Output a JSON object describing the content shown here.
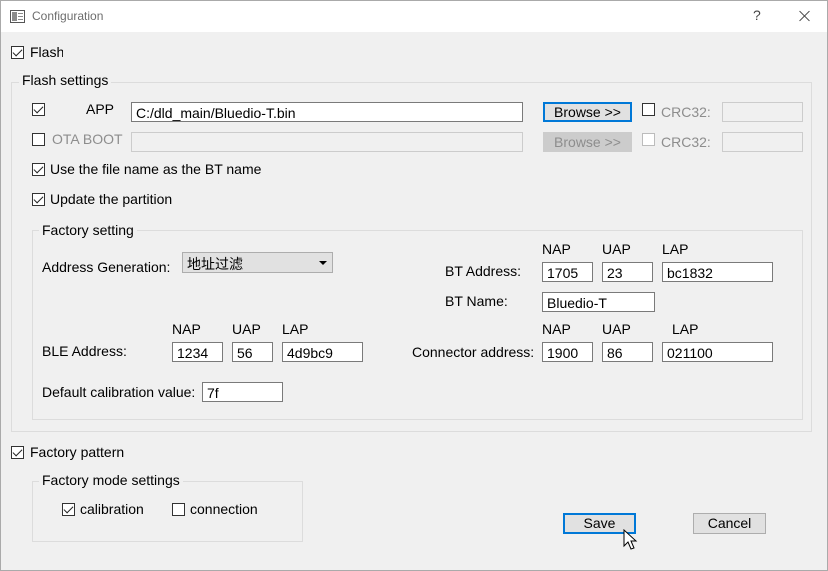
{
  "window": {
    "title": "Configuration",
    "help_label": "?"
  },
  "flash": {
    "label": "Flash",
    "checked": true,
    "settings_title": "Flash settings",
    "app": {
      "label": "APP",
      "checked": true,
      "path": "C:/dld_main/Bluedio-T.bin",
      "browse_label": "Browse >>",
      "crc_label": "CRC32:",
      "crc_value": "",
      "crc_checked": false
    },
    "ota": {
      "label": "OTA BOOT",
      "checked": false,
      "path": "",
      "browse_label": "Browse >>",
      "crc_label": "CRC32:",
      "crc_value": ""
    },
    "use_filename_label": "Use the file name as the BT name",
    "update_partition_label": "Update the partition"
  },
  "factory_setting": {
    "title": "Factory setting",
    "address_generation_label": "Address Generation:",
    "address_generation_value": "地址过滤",
    "bt_address": {
      "label": "BT Address:",
      "nap_label": "NAP",
      "uap_label": "UAP",
      "lap_label": "LAP",
      "nap": "1705",
      "uap": "23",
      "lap": "bc1832"
    },
    "bt_name": {
      "label": "BT Name:",
      "value": "Bluedio-T"
    },
    "ble_address": {
      "label": "BLE Address:",
      "nap_label": "NAP",
      "uap_label": "UAP",
      "lap_label": "LAP",
      "nap": "1234",
      "uap": "56",
      "lap": "4d9bc9"
    },
    "connector_address": {
      "label": "Connector address:",
      "nap_label": "NAP",
      "uap_label": "UAP",
      "lap_label": "LAP",
      "nap": "1900",
      "uap": "86",
      "lap": "021100"
    },
    "calibration": {
      "label": "Default calibration value:",
      "value": "7f"
    }
  },
  "factory_pattern": {
    "label": "Factory pattern",
    "checked": true,
    "mode_title": "Factory mode settings",
    "calibration_label": "calibration",
    "calibration_checked": true,
    "connection_label": "connection",
    "connection_checked": false
  },
  "actions": {
    "save_label": "Save",
    "cancel_label": "Cancel"
  }
}
